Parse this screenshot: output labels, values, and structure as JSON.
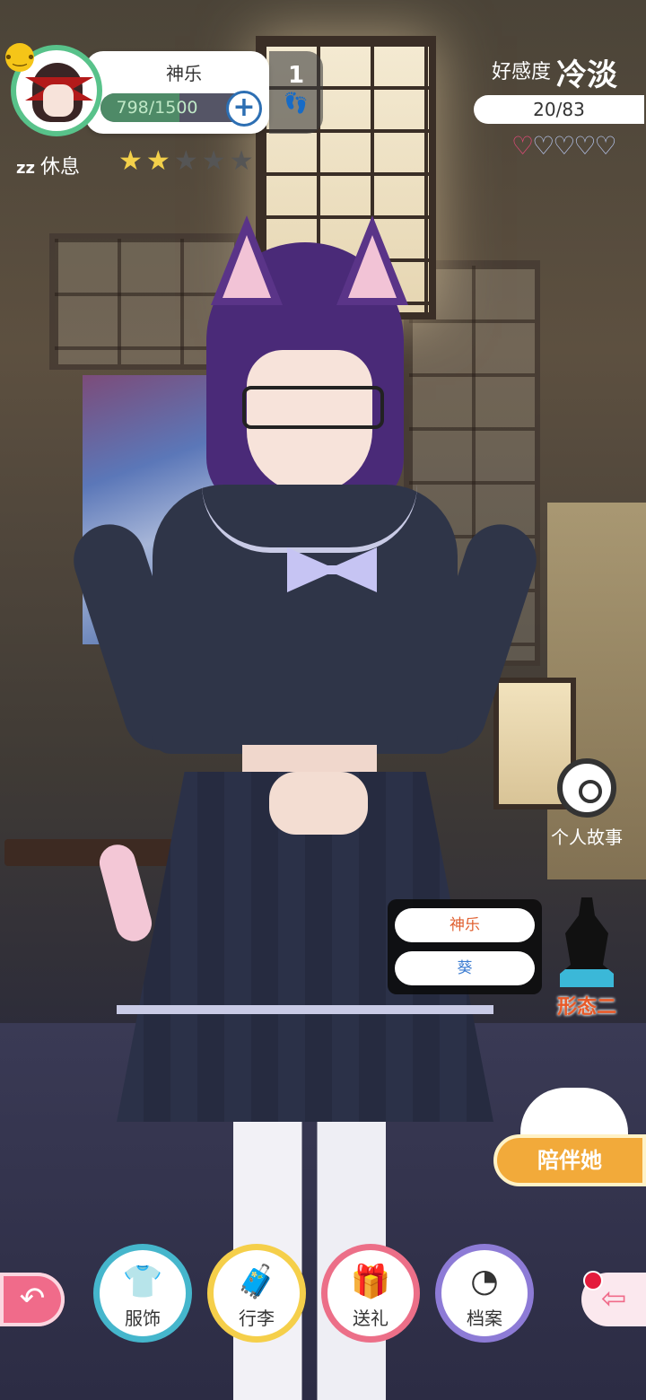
{
  "profile": {
    "name": "神乐",
    "exp_text": "798/1500",
    "exp_fraction": 0.532,
    "step_count": "1",
    "status_label": "休息",
    "status_icon_text": "zz",
    "stars_total": 5,
    "stars_filled": 2
  },
  "affection": {
    "label": "好感度",
    "level": "冷淡",
    "progress_text": "20/83",
    "hearts_total": 5,
    "hearts_filled_fraction": 0.1
  },
  "side": {
    "story_label": "个人故事",
    "form_label": "形态二",
    "variants": [
      "神乐",
      "葵"
    ],
    "accompany_label": "陪伴她"
  },
  "bottom_nav": [
    {
      "label": "服饰",
      "icon": "shirt-icon",
      "color": "#45b6cc"
    },
    {
      "label": "行李",
      "icon": "luggage-icon",
      "color": "#f5cf4a"
    },
    {
      "label": "送礼",
      "icon": "gift-icon",
      "color": "#ec6f88"
    },
    {
      "label": "档案",
      "icon": "file-icon",
      "color": "#8d7bd6"
    }
  ],
  "colors": {
    "accent_green": "#58c28a",
    "accompany_orange": "#f2aa3a",
    "back_pink": "#f06b8a"
  }
}
